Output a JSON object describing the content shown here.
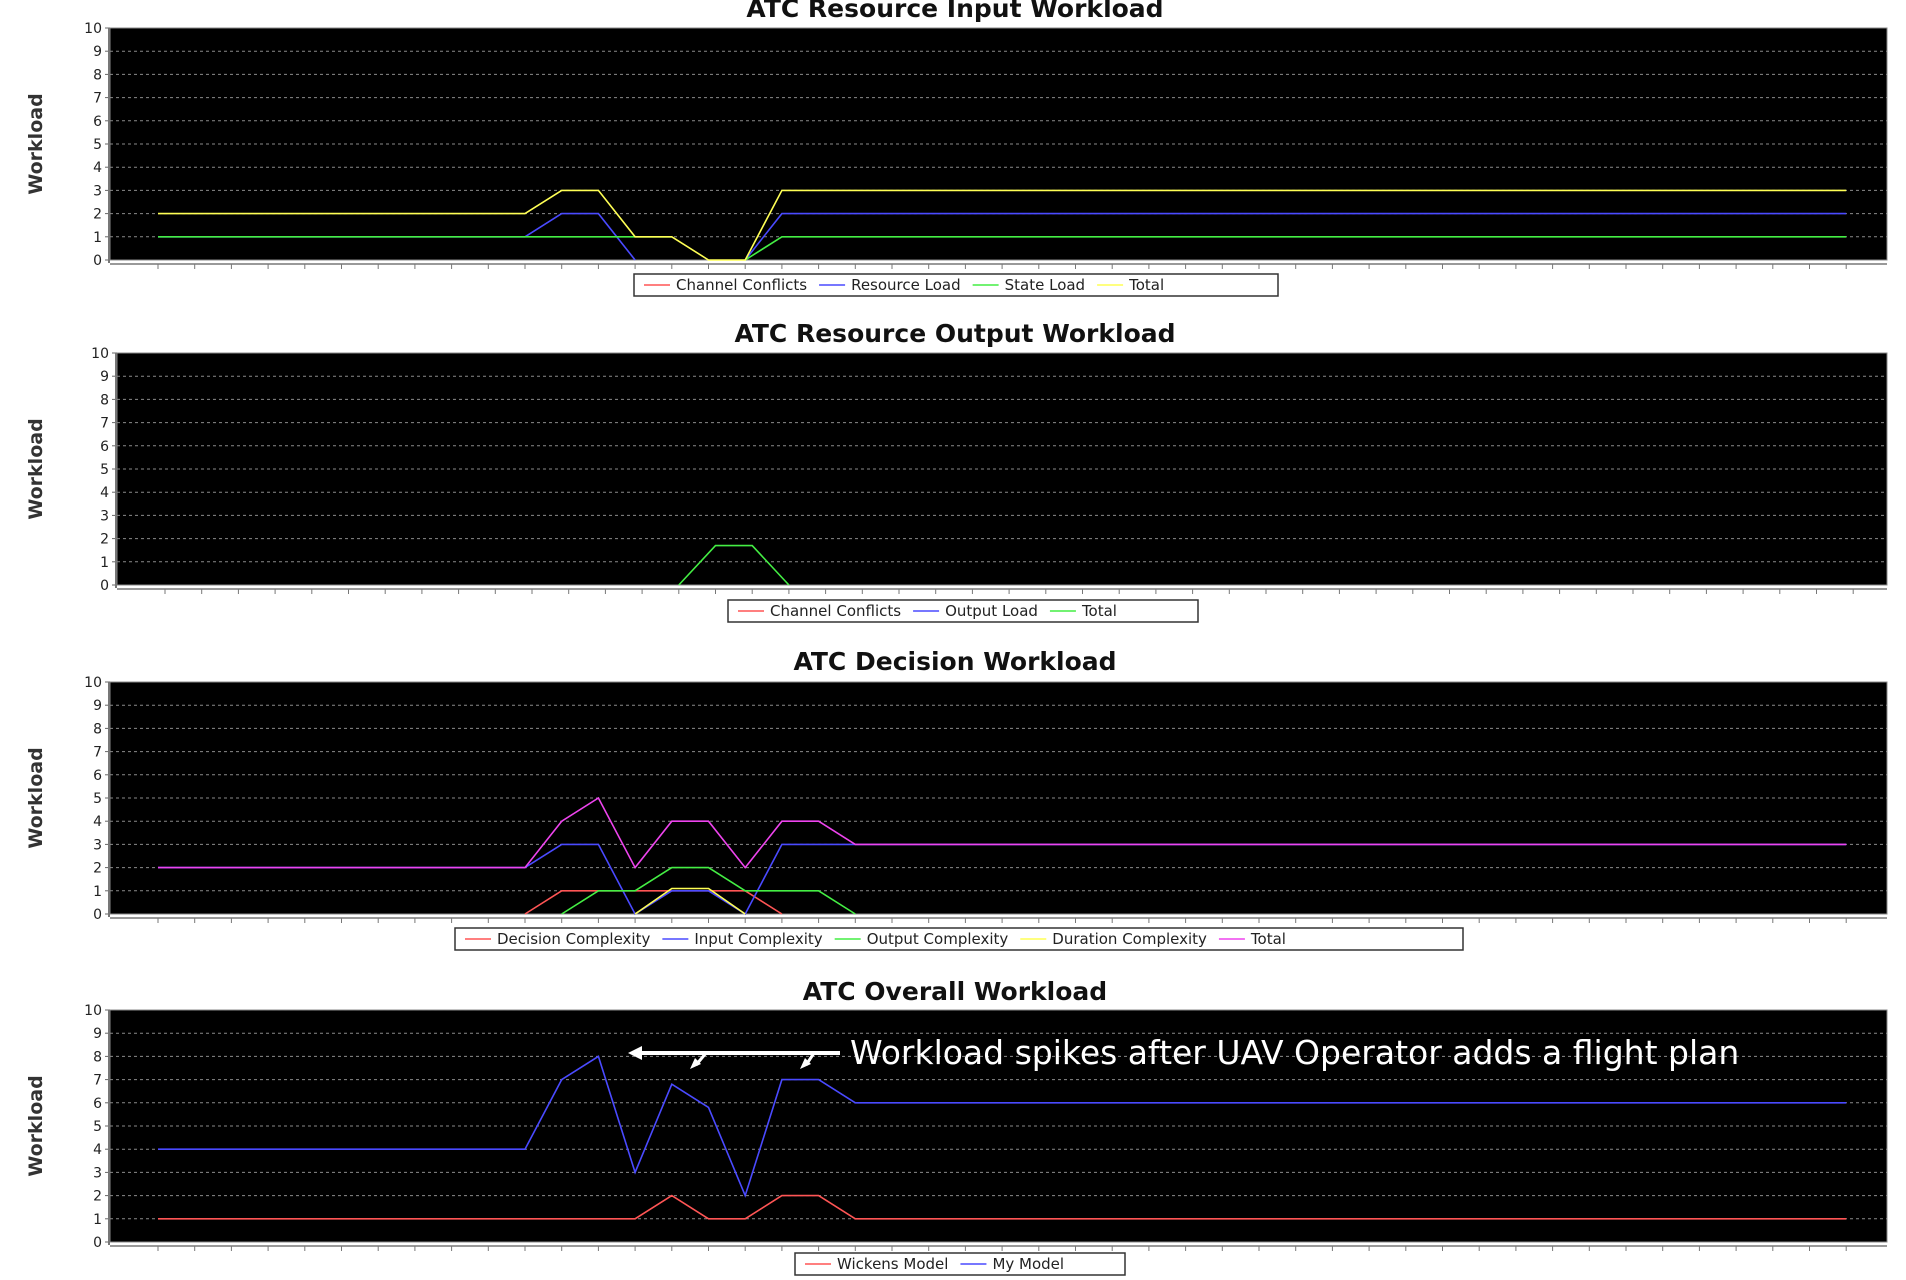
{
  "chart_data": [
    {
      "type": "line",
      "title": "ATC Resource Input Workload",
      "ylabel": "Workload",
      "xlabel": "",
      "ylim": [
        0,
        10
      ],
      "yticks": [
        0,
        1,
        2,
        3,
        4,
        5,
        6,
        7,
        8,
        9,
        10
      ],
      "grid": true,
      "legend_position": "bottom",
      "x": [
        0,
        1,
        2,
        3,
        4,
        5,
        6,
        7,
        8,
        9,
        10,
        11,
        12,
        13,
        14,
        15,
        16,
        17,
        18,
        19,
        20,
        21,
        22,
        23,
        24,
        25,
        26,
        27,
        28,
        29,
        30,
        31,
        32,
        33,
        34,
        35,
        36,
        37,
        38,
        39,
        40,
        41,
        42,
        43,
        44,
        45,
        46
      ],
      "series": [
        {
          "name": "Channel Conflicts",
          "color": "#ff5555",
          "values": []
        },
        {
          "name": "Resource Load",
          "color": "#4a4aff",
          "values": [
            1,
            1,
            1,
            1,
            1,
            1,
            1,
            1,
            1,
            1,
            1,
            2,
            2,
            0,
            null,
            null,
            0,
            2,
            2,
            2,
            2,
            2,
            2,
            2,
            2,
            2,
            2,
            2,
            2,
            2,
            2,
            2,
            2,
            2,
            2,
            2,
            2,
            2,
            2,
            2,
            2,
            2,
            2,
            2,
            2,
            2,
            2
          ]
        },
        {
          "name": "State Load",
          "color": "#44ee44",
          "values": [
            1,
            1,
            1,
            1,
            1,
            1,
            1,
            1,
            1,
            1,
            1,
            1,
            1,
            1,
            1,
            null,
            0,
            1,
            1,
            1,
            1,
            1,
            1,
            1,
            1,
            1,
            1,
            1,
            1,
            1,
            1,
            1,
            1,
            1,
            1,
            1,
            1,
            1,
            1,
            1,
            1,
            1,
            1,
            1,
            1,
            1,
            1
          ]
        },
        {
          "name": "Total",
          "color": "#ffff55",
          "values": [
            2,
            2,
            2,
            2,
            2,
            2,
            2,
            2,
            2,
            2,
            2,
            3,
            3,
            1,
            1,
            0,
            0,
            3,
            3,
            3,
            3,
            3,
            3,
            3,
            3,
            3,
            3,
            3,
            3,
            3,
            3,
            3,
            3,
            3,
            3,
            3,
            3,
            3,
            3,
            3,
            3,
            3,
            3,
            3,
            3,
            3,
            3
          ]
        }
      ]
    },
    {
      "type": "line",
      "title": "ATC Resource Output Workload",
      "ylabel": "Workload",
      "xlabel": "",
      "ylim": [
        0,
        10
      ],
      "yticks": [
        0,
        1,
        2,
        3,
        4,
        5,
        6,
        7,
        8,
        9,
        10
      ],
      "grid": true,
      "legend_position": "bottom",
      "x": [
        0,
        1,
        2,
        3,
        4,
        5,
        6,
        7,
        8,
        9,
        10,
        11,
        12,
        13,
        14,
        15,
        16,
        17,
        18,
        19,
        20,
        21,
        22,
        23,
        24,
        25,
        26,
        27,
        28,
        29,
        30,
        31,
        32,
        33,
        34,
        35,
        36,
        37,
        38,
        39,
        40,
        41,
        42,
        43,
        44,
        45,
        46
      ],
      "series": [
        {
          "name": "Channel Conflicts",
          "color": "#ff5555",
          "values": []
        },
        {
          "name": "Output Load",
          "color": "#4a4aff",
          "values": []
        },
        {
          "name": "Total",
          "color": "#44ee44",
          "values": [
            null,
            null,
            null,
            null,
            null,
            null,
            null,
            null,
            null,
            null,
            null,
            null,
            null,
            null,
            0,
            1.7,
            1.7,
            0,
            null,
            null,
            null,
            null,
            null,
            null,
            null,
            null,
            null,
            null,
            null,
            null,
            null,
            null,
            null,
            null,
            null,
            null,
            null,
            null,
            null,
            null,
            null,
            null,
            null,
            null,
            null,
            null,
            null
          ]
        }
      ]
    },
    {
      "type": "line",
      "title": "ATC Decision Workload",
      "ylabel": "Workload",
      "xlabel": "",
      "ylim": [
        0,
        10
      ],
      "yticks": [
        0,
        1,
        2,
        3,
        4,
        5,
        6,
        7,
        8,
        9,
        10
      ],
      "grid": true,
      "legend_position": "bottom",
      "x": [
        0,
        1,
        2,
        3,
        4,
        5,
        6,
        7,
        8,
        9,
        10,
        11,
        12,
        13,
        14,
        15,
        16,
        17,
        18,
        19,
        20,
        21,
        22,
        23,
        24,
        25,
        26,
        27,
        28,
        29,
        30,
        31,
        32,
        33,
        34,
        35,
        36,
        37,
        38,
        39,
        40,
        41,
        42,
        43,
        44,
        45,
        46
      ],
      "series": [
        {
          "name": "Decision Complexity",
          "color": "#ff5555",
          "values": [
            null,
            null,
            null,
            null,
            null,
            null,
            null,
            null,
            null,
            null,
            0,
            1,
            1,
            1,
            1,
            1,
            1,
            0,
            null,
            null,
            null,
            null,
            null,
            null,
            null,
            null,
            null,
            null,
            null,
            null,
            null,
            null,
            null,
            null,
            null,
            null,
            null,
            null,
            null,
            null,
            null,
            null,
            null,
            null,
            null,
            null,
            null
          ]
        },
        {
          "name": "Input Complexity",
          "color": "#4a4aff",
          "values": [
            2,
            2,
            2,
            2,
            2,
            2,
            2,
            2,
            2,
            2,
            2,
            3,
            3,
            0,
            1,
            1,
            0,
            3,
            3,
            3,
            3,
            3,
            3,
            3,
            3,
            3,
            3,
            3,
            3,
            3,
            3,
            3,
            3,
            3,
            3,
            3,
            3,
            3,
            3,
            3,
            3,
            3,
            3,
            3,
            3,
            3,
            3
          ]
        },
        {
          "name": "Output Complexity",
          "color": "#44ee44",
          "values": [
            null,
            null,
            null,
            null,
            null,
            null,
            null,
            null,
            null,
            null,
            null,
            0,
            1,
            1,
            2,
            2,
            1,
            1,
            1,
            0,
            null,
            null,
            null,
            null,
            null,
            null,
            null,
            null,
            null,
            null,
            null,
            null,
            null,
            null,
            null,
            null,
            null,
            null,
            null,
            null,
            null,
            null,
            null,
            null,
            null,
            null,
            null
          ]
        },
        {
          "name": "Duration Complexity",
          "color": "#ffff55",
          "values": [
            null,
            null,
            null,
            null,
            null,
            null,
            null,
            null,
            null,
            null,
            null,
            null,
            null,
            0,
            1.1,
            1.1,
            0,
            null,
            null,
            null,
            null,
            null,
            null,
            null,
            null,
            null,
            null,
            null,
            null,
            null,
            null,
            null,
            null,
            null,
            null,
            null,
            null,
            null,
            null,
            null,
            null,
            null,
            null,
            null,
            null,
            null,
            null
          ]
        },
        {
          "name": "Total",
          "color": "#ee44ee",
          "values": [
            2,
            2,
            2,
            2,
            2,
            2,
            2,
            2,
            2,
            2,
            2,
            4,
            5,
            2,
            4,
            4,
            2,
            4,
            4,
            3,
            3,
            3,
            3,
            3,
            3,
            3,
            3,
            3,
            3,
            3,
            3,
            3,
            3,
            3,
            3,
            3,
            3,
            3,
            3,
            3,
            3,
            3,
            3,
            3,
            3,
            3,
            3
          ]
        }
      ]
    },
    {
      "type": "line",
      "title": "ATC Overall Workload",
      "ylabel": "Workload",
      "xlabel": "",
      "ylim": [
        0,
        10
      ],
      "yticks": [
        0,
        1,
        2,
        3,
        4,
        5,
        6,
        7,
        8,
        9,
        10
      ],
      "grid": true,
      "legend_position": "bottom",
      "annotation": "Workload spikes after UAV Operator adds a flight plan",
      "x": [
        0,
        1,
        2,
        3,
        4,
        5,
        6,
        7,
        8,
        9,
        10,
        11,
        12,
        13,
        14,
        15,
        16,
        17,
        18,
        19,
        20,
        21,
        22,
        23,
        24,
        25,
        26,
        27,
        28,
        29,
        30,
        31,
        32,
        33,
        34,
        35,
        36,
        37,
        38,
        39,
        40,
        41,
        42,
        43,
        44,
        45,
        46
      ],
      "series": [
        {
          "name": "Wickens Model",
          "color": "#ff5555",
          "values": [
            1,
            1,
            1,
            1,
            1,
            1,
            1,
            1,
            1,
            1,
            1,
            1,
            1,
            1,
            2,
            1,
            1,
            2,
            2,
            1,
            1,
            1,
            1,
            1,
            1,
            1,
            1,
            1,
            1,
            1,
            1,
            1,
            1,
            1,
            1,
            1,
            1,
            1,
            1,
            1,
            1,
            1,
            1,
            1,
            1,
            1,
            1
          ]
        },
        {
          "name": "My Model",
          "color": "#4a4aff",
          "values": [
            4,
            4,
            4,
            4,
            4,
            4,
            4,
            4,
            4,
            4,
            4,
            7,
            8,
            3,
            6.8,
            5.8,
            2,
            7,
            7,
            6,
            6,
            6,
            6,
            6,
            6,
            6,
            6,
            6,
            6,
            6,
            6,
            6,
            6,
            6,
            6,
            6,
            6,
            6,
            6,
            6,
            6,
            6,
            6,
            6,
            6,
            6,
            6
          ]
        }
      ]
    }
  ]
}
